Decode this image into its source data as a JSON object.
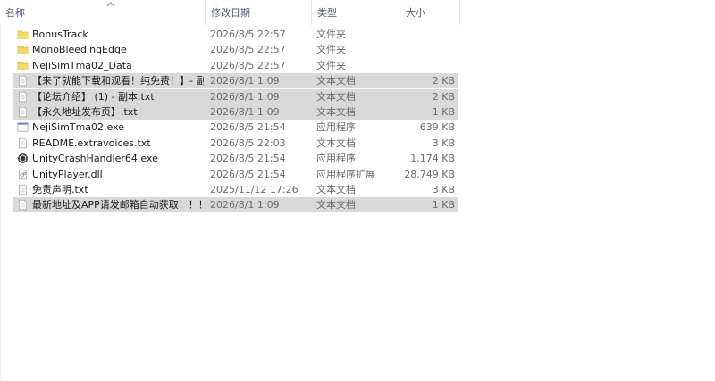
{
  "columns": {
    "name": "名称",
    "date": "修改日期",
    "type": "类型",
    "size": "大小"
  },
  "colors": {
    "header_text": "#4d6082",
    "selected_row": "#d9d9d9",
    "folder": "#f2c94c"
  },
  "files": [
    {
      "name": "BonusTrack",
      "date": "2026/8/5 22:57",
      "type": "文件夹",
      "size": "",
      "icon": "folder-icon",
      "selected": false
    },
    {
      "name": "MonoBleedingEdge",
      "date": "2026/8/5 22:57",
      "type": "文件夹",
      "size": "",
      "icon": "folder-icon",
      "selected": false
    },
    {
      "name": "NejiSimTma02_Data",
      "date": "2026/8/5 22:57",
      "type": "文件夹",
      "size": "",
      "icon": "folder-icon",
      "selected": false
    },
    {
      "name": "【来了就能下载和观看！纯免费！】- 副...",
      "date": "2026/8/1 1:09",
      "type": "文本文档",
      "size": "2 KB",
      "icon": "text-file-icon",
      "selected": true
    },
    {
      "name": "【论坛介绍】 (1) - 副本.txt",
      "date": "2026/8/1 1:09",
      "type": "文本文档",
      "size": "2 KB",
      "icon": "text-file-icon",
      "selected": true
    },
    {
      "name": "【永久地址发布页】.txt",
      "date": "2026/8/1 1:09",
      "type": "文本文档",
      "size": "1 KB",
      "icon": "text-file-icon",
      "selected": true
    },
    {
      "name": "NejiSimTma02.exe",
      "date": "2026/8/5 21:54",
      "type": "应用程序",
      "size": "639 KB",
      "icon": "exe-icon",
      "selected": false
    },
    {
      "name": "README.extravoices.txt",
      "date": "2026/8/5 22:03",
      "type": "文本文档",
      "size": "3 KB",
      "icon": "text-file-icon",
      "selected": false
    },
    {
      "name": "UnityCrashHandler64.exe",
      "date": "2026/8/5 21:54",
      "type": "应用程序",
      "size": "1,174 KB",
      "icon": "unity-icon",
      "selected": false
    },
    {
      "name": "UnityPlayer.dll",
      "date": "2026/8/5 21:54",
      "type": "应用程序扩展",
      "size": "28,749 KB",
      "icon": "dll-icon",
      "selected": false
    },
    {
      "name": "免责声明.txt",
      "date": "2025/11/12 17:26",
      "type": "文本文档",
      "size": "3 KB",
      "icon": "text-file-icon",
      "selected": false
    },
    {
      "name": "最新地址及APP请发邮箱自动获取！！！...",
      "date": "2026/8/1 1:09",
      "type": "文本文档",
      "size": "1 KB",
      "icon": "text-file-icon",
      "selected": true
    }
  ]
}
